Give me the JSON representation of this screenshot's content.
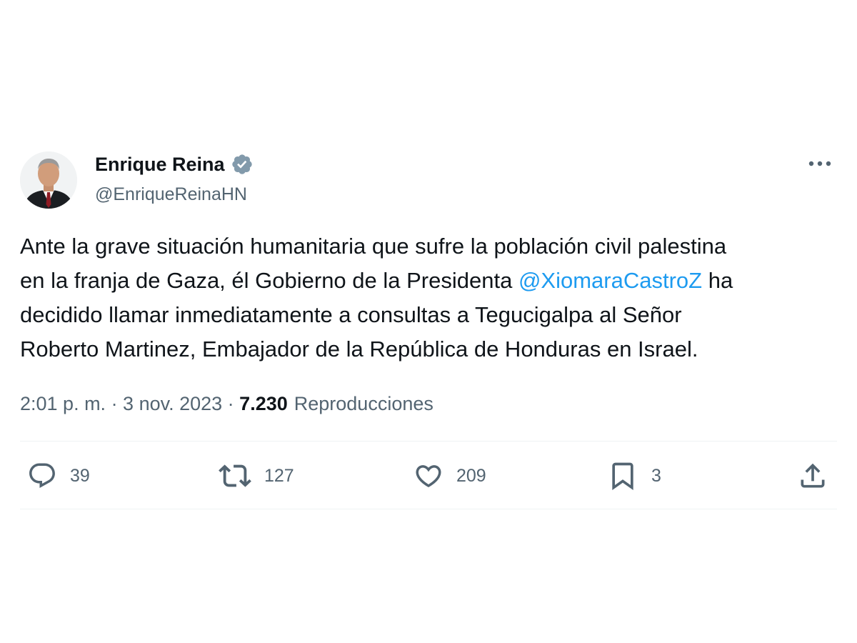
{
  "tweet": {
    "author": {
      "display_name": "Enrique Reina",
      "handle": "@EnriqueReinaHN",
      "verified": true
    },
    "text_before_mention": "Ante la grave situación humanitaria que sufre la población civil palestina\nen la franja de Gaza, él Gobierno de la Presidenta ",
    "mention": "@XiomaraCastroZ",
    "text_after_mention": " ha\ndecidido llamar inmediatamente a consultas a Tegucigalpa al Señor\nRoberto Martinez, Embajador de la República de Honduras en Israel.",
    "timestamp": "2:01 p. m. · 3 nov. 2023 · ",
    "views_count": "7.230",
    "views_label": "Reproducciones",
    "stats": {
      "replies": "39",
      "retweets": "127",
      "likes": "209",
      "bookmarks": "3"
    }
  },
  "icons": {
    "more": "more-horizontal-icon",
    "verified": "verified-badge-icon",
    "reply": "reply-bubble-icon",
    "retweet": "retweet-arrows-icon",
    "like": "heart-icon",
    "bookmark": "bookmark-icon",
    "share": "share-upload-icon"
  },
  "colors": {
    "text": "#0f1419",
    "secondary": "#536471",
    "accent": "#1d9bf0",
    "verified_badge": "#829aab",
    "divider": "#eff3f4"
  }
}
